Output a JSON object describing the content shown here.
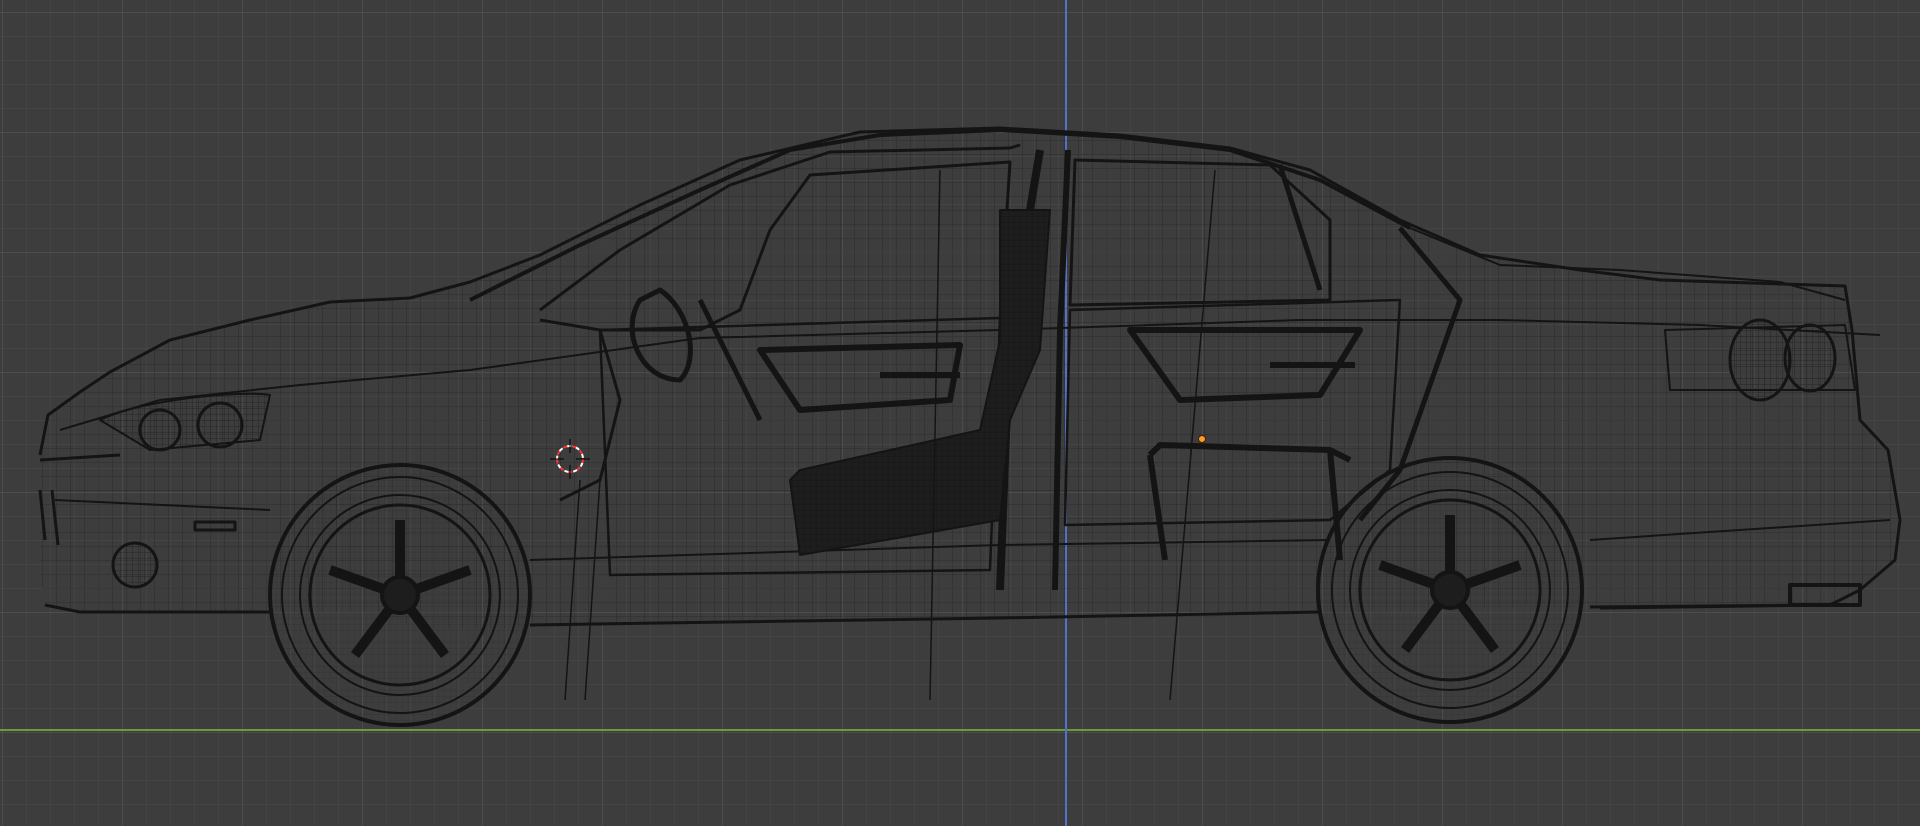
{
  "viewport": {
    "view": "side-orthographic",
    "shading": "wireframe",
    "grid_visible": true,
    "background_color": "#3d3d3d",
    "grid_minor_color": "#4a4a4a",
    "grid_major_color": "#555555",
    "axis_z_color": "#5271c9",
    "axis_y_color": "#6c9a3c",
    "wire_color": "#141414",
    "object_origin_color": "#ff9a2a",
    "cursor_3d_colors": [
      "#ff3333",
      "#ffffff"
    ],
    "icons": {
      "cursor": "3d-cursor-icon",
      "origin": "object-origin-dot-icon"
    }
  },
  "model": {
    "type": "sedan-car-wireframe",
    "doors_open": true,
    "wheel_count_visible": 2
  }
}
